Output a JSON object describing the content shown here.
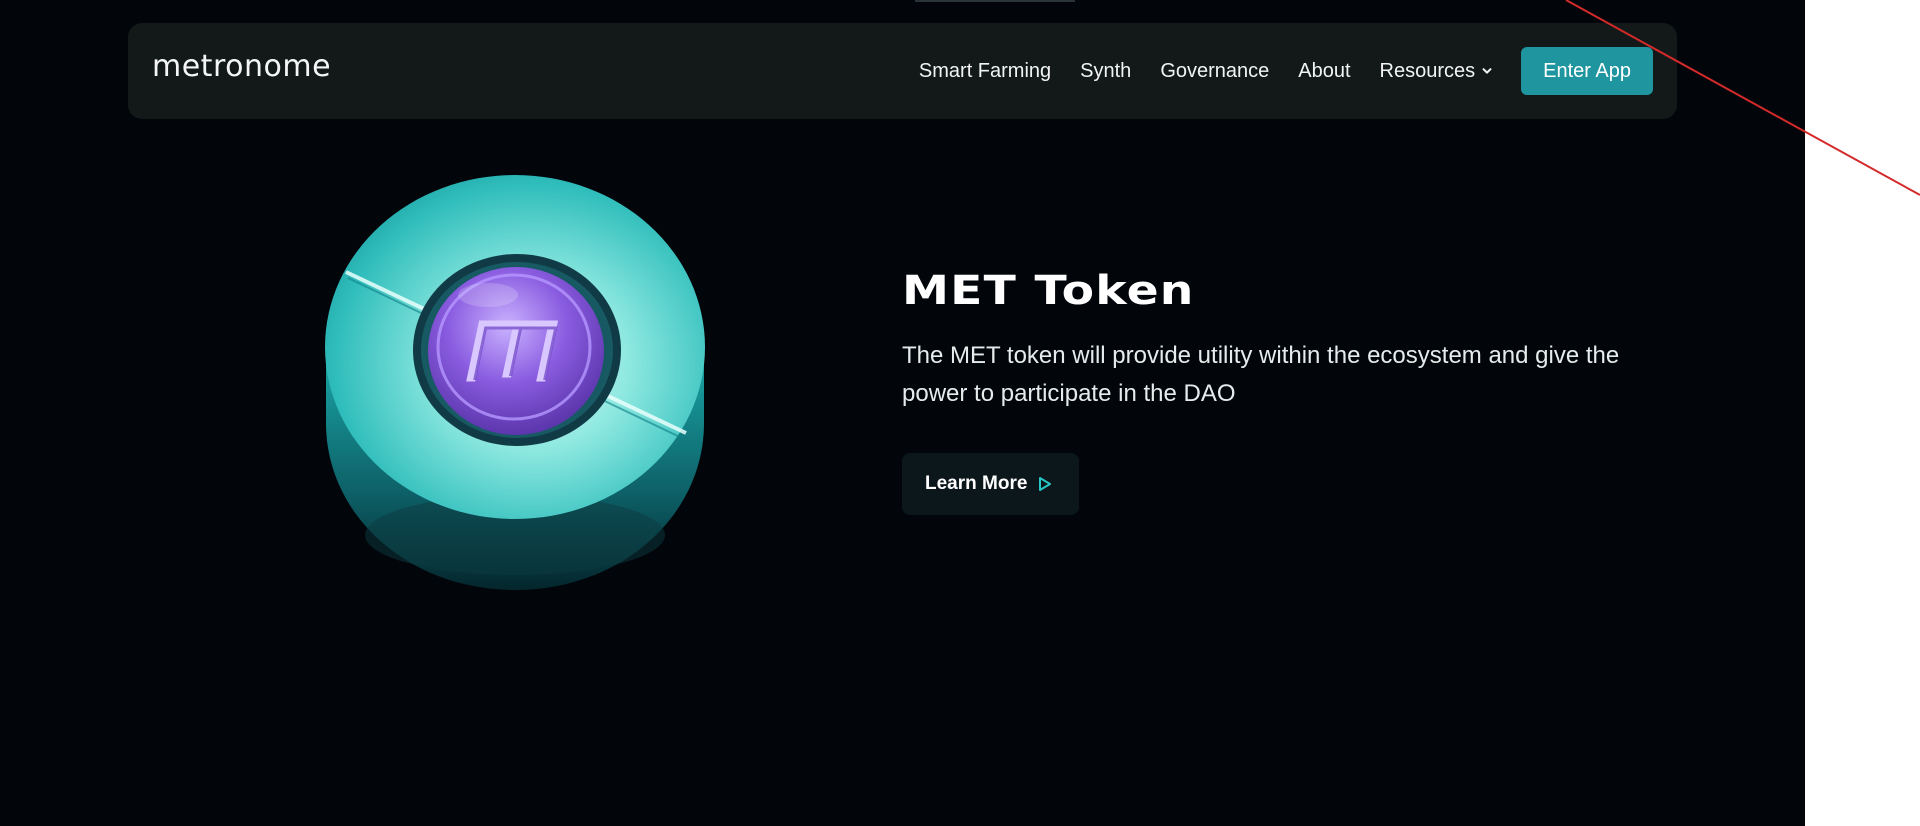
{
  "brand": {
    "logo_text": "metronome"
  },
  "nav": {
    "links": [
      {
        "label": "Smart Farming"
      },
      {
        "label": "Synth"
      },
      {
        "label": "Governance"
      },
      {
        "label": "About"
      }
    ],
    "resources_label": "Resources",
    "enter_app_label": "Enter App"
  },
  "hero": {
    "title": "MET Token",
    "description": "The MET token will provide utility within the ecosystem and give the power to participate in the DAO",
    "learn_more_label": "Learn More"
  },
  "icons": {
    "resources_dropdown": "chevron-down-icon",
    "learn_more": "play-outline-icon",
    "token_emblem": "met-token-icon"
  },
  "colors": {
    "background": "#02060b",
    "navbar": "#131819",
    "accent": "#1e959f",
    "token_teal": "#27c6c4",
    "token_purple": "#8a5ce0",
    "annotation_line": "#d42a2a"
  }
}
